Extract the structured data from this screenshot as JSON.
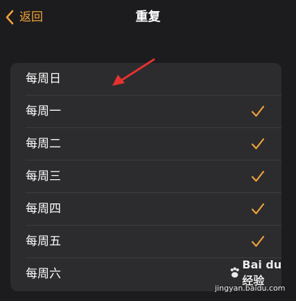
{
  "navbar": {
    "back_label": "返回",
    "title": "重复"
  },
  "days": [
    {
      "label": "每周日",
      "checked": false
    },
    {
      "label": "每周一",
      "checked": true
    },
    {
      "label": "每周二",
      "checked": true
    },
    {
      "label": "每周三",
      "checked": true
    },
    {
      "label": "每周四",
      "checked": true
    },
    {
      "label": "每周五",
      "checked": true
    },
    {
      "label": "每周六",
      "checked": false
    }
  ],
  "icons": {
    "back": "chevron-left-icon",
    "check": "checkmark-icon",
    "annotation": "red-arrow-icon"
  },
  "colors": {
    "accent": "#f2a33a",
    "background": "#1c1c1e",
    "card": "#2c2c2e",
    "annotation": "#e8312f"
  },
  "watermark": {
    "logo_text": "Bai du 经验",
    "url": "jingyan.baidu.com"
  }
}
